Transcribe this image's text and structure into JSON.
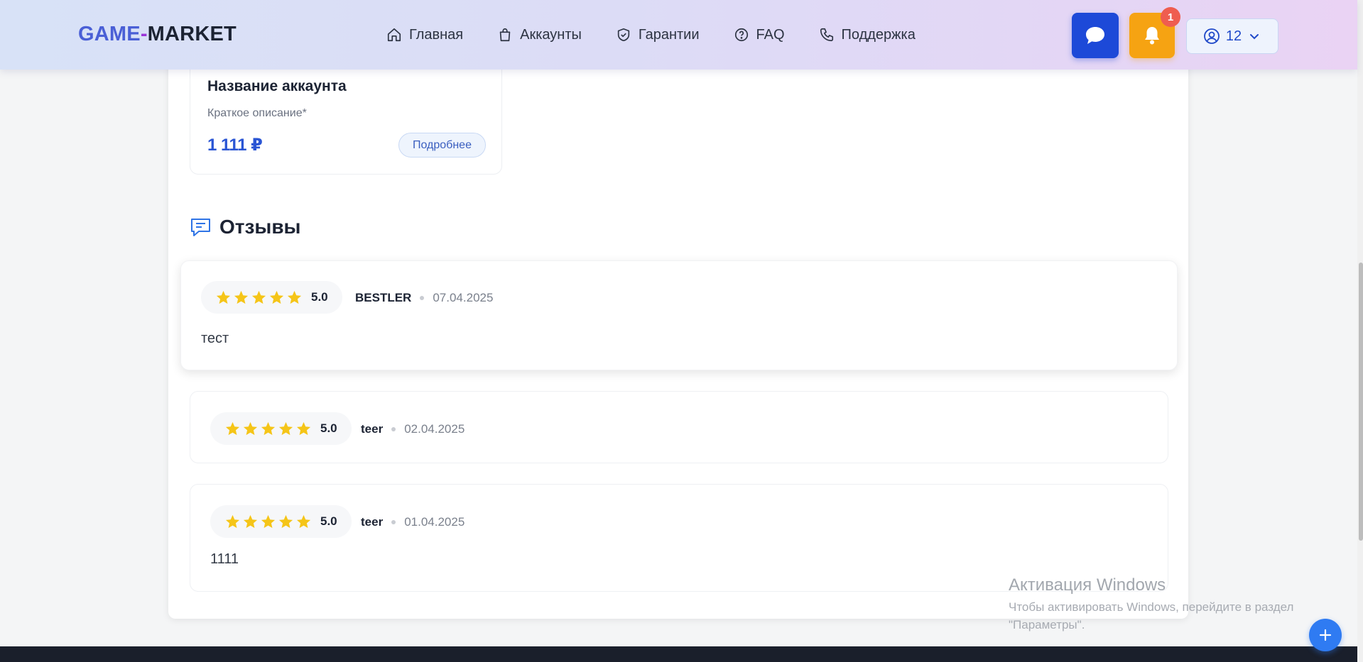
{
  "header": {
    "logo": {
      "part1": "GAME",
      "part2": "-",
      "part3": "MARKET"
    },
    "nav": [
      {
        "label": "Главная",
        "icon": "home-icon"
      },
      {
        "label": "Аккаунты",
        "icon": "shopping-bag-icon"
      },
      {
        "label": "Гарантии",
        "icon": "shield-check-icon"
      },
      {
        "label": "FAQ",
        "icon": "question-circle-icon"
      },
      {
        "label": "Поддержка",
        "icon": "phone-icon"
      }
    ],
    "notifications_count": "1",
    "user_balance": "12"
  },
  "account_card": {
    "title": "Название аккаунта",
    "description": "Краткое описание*",
    "price": "1 111 ₽",
    "more_label": "Подробнее"
  },
  "reviews": {
    "title": "Отзывы",
    "items": [
      {
        "rating": "5.0",
        "stars": 5,
        "author": "BESTLER",
        "date": "07.04.2025",
        "text": "тест"
      },
      {
        "rating": "5.0",
        "stars": 5,
        "author": "teer",
        "date": "02.04.2025",
        "text": ""
      },
      {
        "rating": "5.0",
        "stars": 5,
        "author": "teer",
        "date": "01.04.2025",
        "text": "1111"
      }
    ]
  },
  "windows_watermark": {
    "title": "Активация Windows",
    "line1": "Чтобы активировать Windows, перейдите в раздел",
    "line2": "\"Параметры\"."
  },
  "colors": {
    "primary": "#1d49d8",
    "accent_orange": "#f6a312",
    "star": "#f5c518",
    "price": "#2a55d4"
  }
}
